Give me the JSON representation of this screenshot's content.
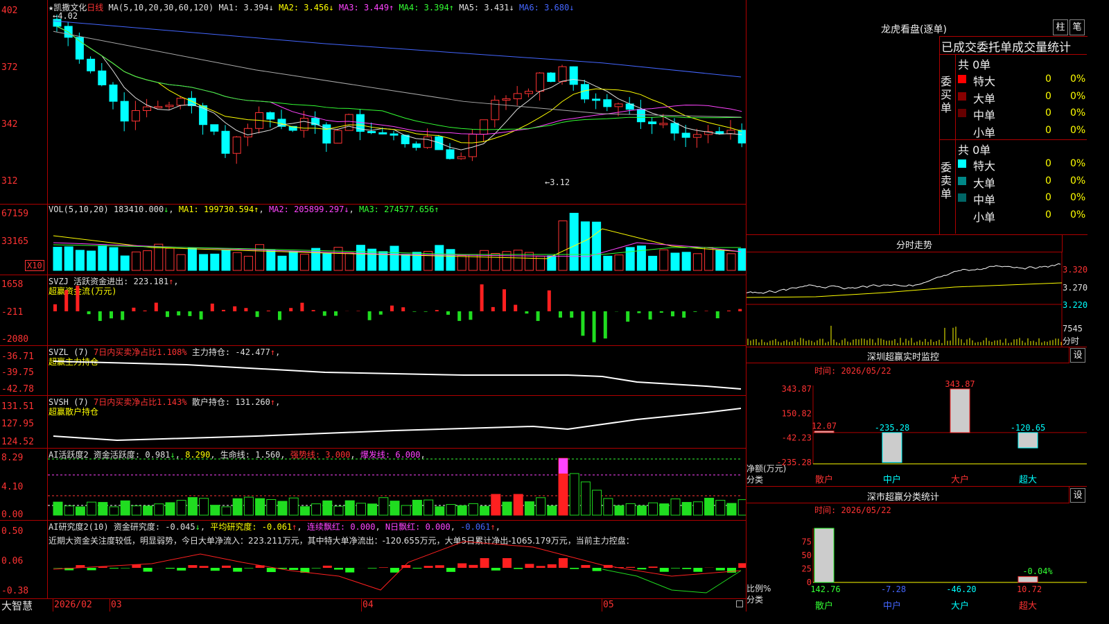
{
  "stock": {
    "title": "★凯撒文化",
    "period": "日线"
  },
  "kline": {
    "ma_label": "MA(5,10,20,30,60,120)",
    "ma": [
      {
        "label": "MA1:",
        "value": "3.394",
        "arrow": "↓",
        "color": "#e0e0e0"
      },
      {
        "label": "MA2:",
        "value": "3.456",
        "arrow": "↓",
        "color": "#ffff00"
      },
      {
        "label": "MA3:",
        "value": "3.449",
        "arrow": "↑",
        "color": "#ff44ff"
      },
      {
        "label": "MA4:",
        "value": "3.394",
        "arrow": "↑",
        "color": "#33ff33"
      },
      {
        "label": "MA5:",
        "value": "3.431",
        "arrow": "↓",
        "color": "#e0e0e0"
      },
      {
        "label": "MA6:",
        "value": "3.680",
        "arrow": "↓",
        "color": "#4466ff"
      }
    ],
    "yticks": [
      "402",
      "372",
      "342",
      "312"
    ],
    "high_mark": "←4.02",
    "low_mark": "←3.12"
  },
  "vol": {
    "label": "VOL(5,10,20)",
    "value": "183410.000",
    "arrow": "↓",
    "ma1": "199730.594",
    "ma2": "205899.297",
    "ma3": "274577.656",
    "yticks": [
      "67159",
      "33165"
    ],
    "unit": "X10"
  },
  "svzj": {
    "label": "SVZJ",
    "title": "活跃资金进出:",
    "value": "223.181",
    "arrow": "↑",
    "sub": "超赢资金流(万元)",
    "yticks": [
      "1658",
      "-211",
      "-2080"
    ]
  },
  "svzl": {
    "label": "SVZL (7)",
    "t1": "7日内买卖净占比1.108%",
    "t2": "主力持仓:",
    "value": "-42.477",
    "arrow": "↑",
    "sub": "超赢主力持仓",
    "yticks": [
      "-36.71",
      "-39.75",
      "-42.78"
    ]
  },
  "svsh": {
    "label": "SVSH (7)",
    "t1": "7日内买卖净占比1.143%",
    "t2": "散户持仓:",
    "value": "131.260",
    "arrow": "↑",
    "sub": "超赢散户持仓",
    "yticks": [
      "131.51",
      "127.95",
      "124.52"
    ]
  },
  "ai1": {
    "label": "AI活跃度2",
    "t1": "资金活跃度:",
    "v1": "0.981",
    "a1": "↓",
    "v2": "8.290",
    "t3": "生命线:",
    "v3": "1.560",
    "t4": "强势线:",
    "v4": "3.000",
    "t5": "爆发线:",
    "v5": "6.000",
    "yticks": [
      "8.29",
      "4.10",
      "0.00"
    ]
  },
  "ai2": {
    "label": "AI研究度2(10)",
    "t1": "资金研究度:",
    "v1": "-0.045",
    "a1": "↓",
    "t2": "平均研究度:",
    "v2": "-0.061",
    "a2": "↑",
    "t3": "连续飘红:",
    "v3": "0.000",
    "t4": "N日飘红:",
    "v4": "0.000",
    "v5": "-0.061",
    "a5": "↑",
    "note": "近期大资金关注度较低，明显弱势，今日大单净流入：223.211万元，其中特大单净流出：-120.655万元，大单5日累计净出-1065.179万元，当前主力控盘：",
    "yticks": [
      "0.50",
      "0.06",
      "-0.38"
    ]
  },
  "bottom": {
    "brand": "大智慧",
    "dates": [
      "2026/02",
      "03",
      "04",
      "05"
    ]
  },
  "dragon": {
    "title": "龙虎看盘(逐单)",
    "btn1": "柱",
    "btn2": "笔",
    "head": "已成交委托单成交量统计",
    "buy": {
      "side": "委买单",
      "total": "共 0单",
      "rows": [
        {
          "label": "特大",
          "v": "0",
          "p": "0%",
          "color": "#ff0000"
        },
        {
          "label": "大单",
          "v": "0",
          "p": "0%",
          "color": "#880000"
        },
        {
          "label": "中单",
          "v": "0",
          "p": "0%",
          "color": "#660000"
        },
        {
          "label": "小单",
          "v": "0",
          "p": "0%",
          "color": "#000000"
        }
      ]
    },
    "sell": {
      "side": "委卖单",
      "total": "共 0单",
      "rows": [
        {
          "label": "特大",
          "v": "0",
          "p": "0%",
          "color": "#00ffff"
        },
        {
          "label": "大单",
          "v": "0",
          "p": "0%",
          "color": "#008888"
        },
        {
          "label": "中单",
          "v": "0",
          "p": "0%",
          "color": "#006666"
        },
        {
          "label": "小单",
          "v": "0",
          "p": "0%",
          "color": "#000000"
        }
      ]
    }
  },
  "minute": {
    "title": "分时走势",
    "p1": "3.320",
    "p2": "3.270",
    "p3": "3.220",
    "vol": "7545",
    "unit": "分时"
  },
  "sz_monitor": {
    "title": "深圳超赢实时监控",
    "btn": "设",
    "time": "时间: 2026/05/22",
    "yticks": [
      "343.87",
      "150.82",
      "-42.23",
      "-235.28"
    ],
    "ylab": "净额(万元)",
    "xlab": "分类",
    "chart_data": {
      "type": "bar",
      "categories": [
        "散户",
        "中户",
        "大户",
        "超大"
      ],
      "values": [
        12.07,
        -235.28,
        343.87,
        -120.65
      ],
      "ylabel": "净额(万元)",
      "xlabel": "分类",
      "ylim": [
        -235.28,
        343.87
      ]
    }
  },
  "sz_class": {
    "title": "深市超赢分类统计",
    "btn": "设",
    "time": "时间: 2026/05/22",
    "yticks": [
      "75",
      "50",
      "25",
      "0"
    ],
    "ylab": "比例%",
    "xlab": "分类",
    "chart_data": {
      "type": "bar",
      "categories": [
        "散户",
        "中户",
        "大户",
        "超大"
      ],
      "values": [
        142.76,
        -7.28,
        -46.2,
        10.72
      ],
      "extra_label": "-0.04%",
      "ylabel": "比例%",
      "xlabel": "分类"
    }
  }
}
